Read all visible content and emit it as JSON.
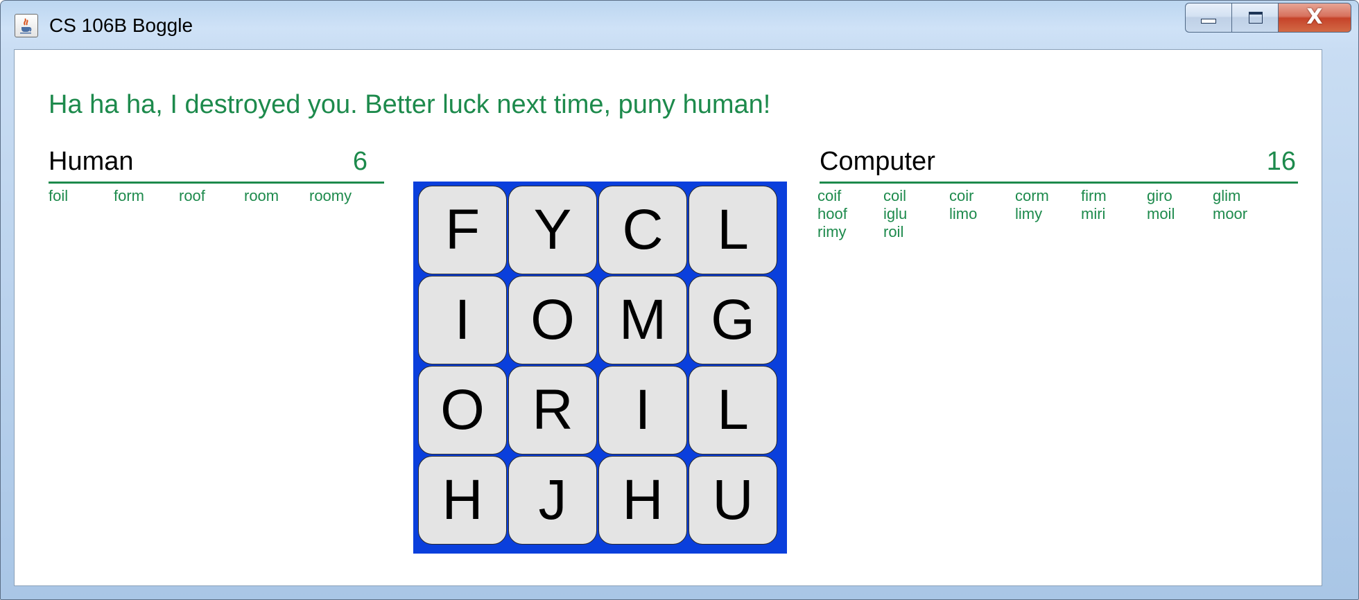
{
  "window": {
    "title": "CS 106B Boggle",
    "app_icon": "java-cup-icon",
    "controls": {
      "minimize": "minimize-icon",
      "maximize": "maximize-icon",
      "close_glyph": "X"
    }
  },
  "status_message": "Ha ha ha, I destroyed you. Better luck next time, puny human!",
  "human": {
    "name": "Human",
    "score": "6",
    "words": [
      "foil",
      "form",
      "roof",
      "room",
      "roomy"
    ]
  },
  "computer": {
    "name": "Computer",
    "score": "16",
    "words": [
      "coif",
      "coil",
      "coir",
      "corm",
      "firm",
      "giro",
      "glim",
      "hoof",
      "iglu",
      "limo",
      "limy",
      "miri",
      "moil",
      "moor",
      "rimy",
      "roil"
    ]
  },
  "board": {
    "rows": [
      [
        "F",
        "Y",
        "C",
        "L"
      ],
      [
        "I",
        "O",
        "M",
        "G"
      ],
      [
        "O",
        "R",
        "I",
        "L"
      ],
      [
        "H",
        "J",
        "H",
        "U"
      ]
    ]
  },
  "colors": {
    "accent_green": "#1d8a4c",
    "board_blue": "#0a3fdc",
    "cube_face": "#e4e4e4"
  }
}
